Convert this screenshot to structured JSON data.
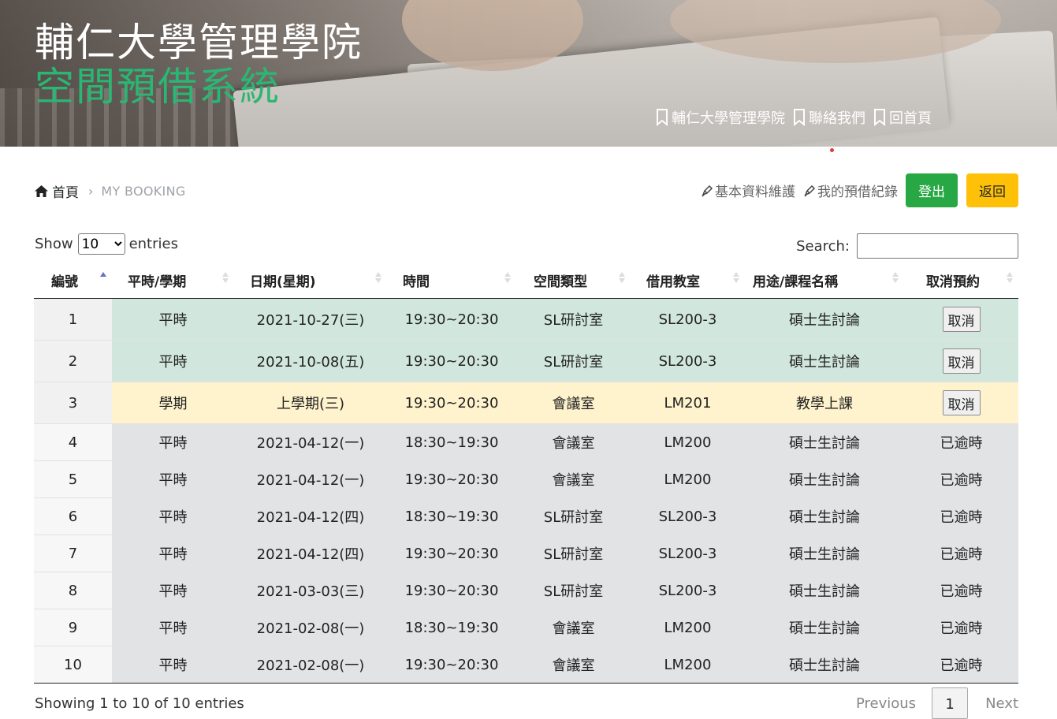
{
  "header": {
    "title_line1": "輔仁大學管理學院",
    "title_line2": "空間預借系統",
    "nav_links": [
      "輔仁大學管理學院",
      "聯絡我們",
      "回首頁"
    ]
  },
  "breadcrumb": {
    "home": "首頁",
    "current": "MY BOOKING"
  },
  "actions": {
    "profile_link": "基本資料維護",
    "records_link": "我的預借紀錄",
    "logout_label": "登出",
    "back_label": "返回"
  },
  "table_controls": {
    "show_label": "Show",
    "entries_label": "entries",
    "length_value": "10",
    "search_label": "Search:",
    "search_value": ""
  },
  "table": {
    "headers": [
      "編號",
      "平時/學期",
      "日期(星期)",
      "時間",
      "空間類型",
      "借用教室",
      "用途/課程名稱",
      "取消預約"
    ],
    "rows": [
      {
        "id": "1",
        "kind": "平時",
        "date": "2021-10-27(三)",
        "time": "19:30~20:30",
        "space": "SL研討室",
        "room": "SL200-3",
        "purpose": "碩士生討論",
        "action": "取消",
        "status": "green",
        "cancel": true
      },
      {
        "id": "2",
        "kind": "平時",
        "date": "2021-10-08(五)",
        "time": "19:30~20:30",
        "space": "SL研討室",
        "room": "SL200-3",
        "purpose": "碩士生討論",
        "action": "取消",
        "status": "green",
        "cancel": true
      },
      {
        "id": "3",
        "kind": "學期",
        "date": "上學期(三)",
        "time": "19:30~20:30",
        "space": "會議室",
        "room": "LM201",
        "purpose": "教學上課",
        "action": "取消",
        "status": "yellow",
        "cancel": true
      },
      {
        "id": "4",
        "kind": "平時",
        "date": "2021-04-12(一)",
        "time": "18:30~19:30",
        "space": "會議室",
        "room": "LM200",
        "purpose": "碩士生討論",
        "action": "已逾時",
        "status": "gray",
        "cancel": false
      },
      {
        "id": "5",
        "kind": "平時",
        "date": "2021-04-12(一)",
        "time": "19:30~20:30",
        "space": "會議室",
        "room": "LM200",
        "purpose": "碩士生討論",
        "action": "已逾時",
        "status": "gray",
        "cancel": false
      },
      {
        "id": "6",
        "kind": "平時",
        "date": "2021-04-12(四)",
        "time": "18:30~19:30",
        "space": "SL研討室",
        "room": "SL200-3",
        "purpose": "碩士生討論",
        "action": "已逾時",
        "status": "gray",
        "cancel": false
      },
      {
        "id": "7",
        "kind": "平時",
        "date": "2021-04-12(四)",
        "time": "19:30~20:30",
        "space": "SL研討室",
        "room": "SL200-3",
        "purpose": "碩士生討論",
        "action": "已逾時",
        "status": "gray",
        "cancel": false
      },
      {
        "id": "8",
        "kind": "平時",
        "date": "2021-03-03(三)",
        "time": "19:30~20:30",
        "space": "SL研討室",
        "room": "SL200-3",
        "purpose": "碩士生討論",
        "action": "已逾時",
        "status": "gray",
        "cancel": false
      },
      {
        "id": "9",
        "kind": "平時",
        "date": "2021-02-08(一)",
        "time": "18:30~19:30",
        "space": "會議室",
        "room": "LM200",
        "purpose": "碩士生討論",
        "action": "已逾時",
        "status": "gray",
        "cancel": false
      },
      {
        "id": "10",
        "kind": "平時",
        "date": "2021-02-08(一)",
        "time": "19:30~20:30",
        "space": "會議室",
        "room": "LM200",
        "purpose": "碩士生討論",
        "action": "已逾時",
        "status": "gray",
        "cancel": false
      }
    ]
  },
  "footer": {
    "info": "Showing 1 to 10 of 10 entries",
    "previous": "Previous",
    "page": "1",
    "next": "Next"
  },
  "colors": {
    "title_green": "#2ab673",
    "row_active": "#d1e7dd",
    "row_semester": "#fff3cd",
    "row_expired": "#e2e3e5",
    "logout": "#28a745",
    "back": "#ffc107"
  },
  "icons": [
    "bookmark-icon",
    "home-icon",
    "pen-icon",
    "sort-icon"
  ]
}
